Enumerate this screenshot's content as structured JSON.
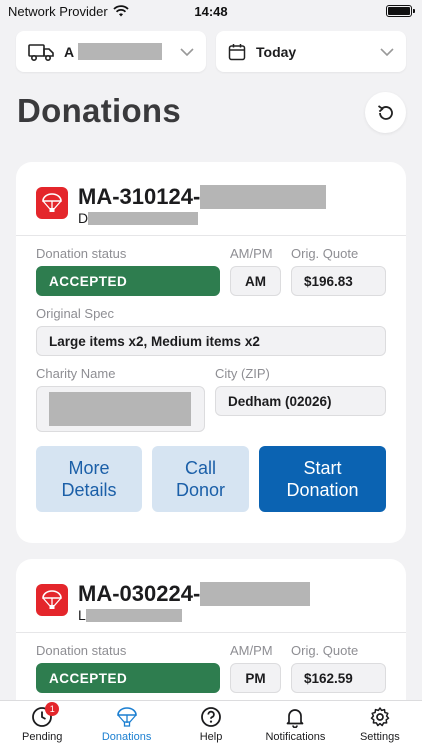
{
  "status_bar": {
    "carrier": "Network Provider",
    "time": "14:48"
  },
  "filters": {
    "truck": {
      "value_prefix": "A",
      "icon": "truck-icon"
    },
    "date": {
      "value": "Today",
      "icon": "calendar-icon"
    }
  },
  "page": {
    "title": "Donations"
  },
  "labels": {
    "status": "Donation status",
    "ampm": "AM/PM",
    "quote": "Orig. Quote",
    "spec": "Original Spec",
    "charity": "Charity Name",
    "city": "City (ZIP)"
  },
  "cards": [
    {
      "id_prefix": "MA-310124-",
      "sub_prefix": "D",
      "status": "ACCEPTED",
      "ampm": "AM",
      "quote": "$196.83",
      "spec": "Large items x2, Medium items x2",
      "city": "Dedham (02026)",
      "actions": {
        "more": "More\nDetails",
        "call": "Call\nDonor",
        "start": "Start\nDonation"
      }
    },
    {
      "id_prefix": "MA-030224-",
      "sub_prefix": "L",
      "status": "ACCEPTED",
      "ampm": "PM",
      "quote": "$162.59"
    }
  ],
  "tabs": [
    {
      "label": "Pending",
      "icon": "clock-icon",
      "badge": "1"
    },
    {
      "label": "Donations",
      "icon": "parachute-icon",
      "active": true
    },
    {
      "label": "Help",
      "icon": "help-icon"
    },
    {
      "label": "Notifications",
      "icon": "bell-icon"
    },
    {
      "label": "Settings",
      "icon": "gear-icon"
    }
  ],
  "colors": {
    "accent": "#1b7fd1",
    "status_accepted": "#2e7d4f",
    "primary_button": "#0b63b2",
    "brand_red": "#e4262b"
  }
}
